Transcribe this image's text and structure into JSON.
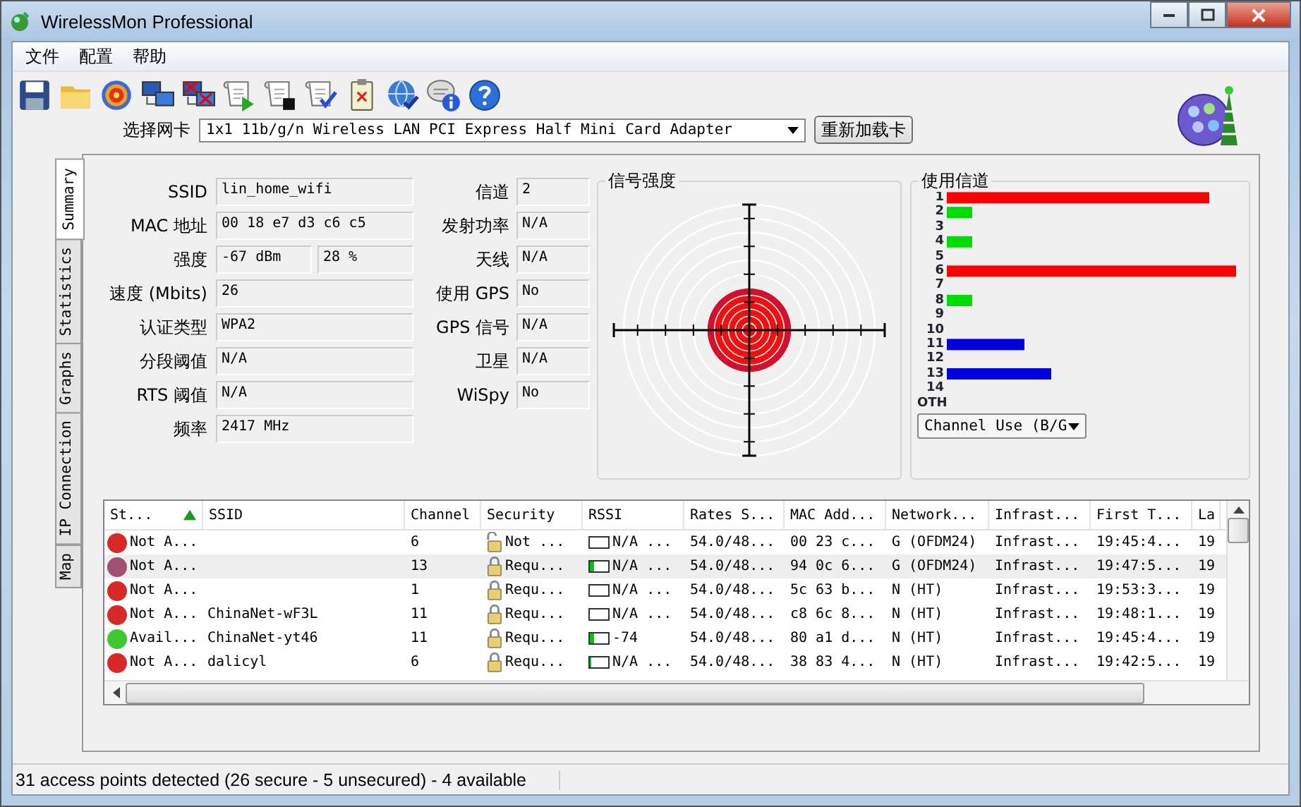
{
  "window": {
    "title": "WirelessMon Professional"
  },
  "menu": [
    "文件",
    "配置",
    "帮助"
  ],
  "adapter": {
    "label": "选择网卡",
    "value": "1x1 11b/g/n Wireless LAN PCI Express Half Mini Card Adapter",
    "reload": "重新加载卡"
  },
  "side_tabs": [
    {
      "label": "Summary",
      "selected": true
    },
    {
      "label": "Statistics",
      "selected": false
    },
    {
      "label": "Graphs",
      "selected": false
    },
    {
      "label": "IP Connection",
      "selected": false
    },
    {
      "label": "Map",
      "selected": false
    }
  ],
  "info_left": [
    {
      "label": "SSID",
      "values": [
        "lin_home_wifi"
      ]
    },
    {
      "label": "MAC 地址",
      "values": [
        "00 18 e7 d3 c6 c5"
      ]
    },
    {
      "label": "强度",
      "values": [
        "-67 dBm",
        "28 %"
      ]
    },
    {
      "label": "速度 (Mbits)",
      "values": [
        "26"
      ]
    },
    {
      "label": "认证类型",
      "values": [
        "WPA2"
      ]
    },
    {
      "label": "分段阈值",
      "values": [
        "N/A"
      ]
    },
    {
      "label": "RTS 阈值",
      "values": [
        "N/A"
      ]
    },
    {
      "label": "频率",
      "values": [
        "2417 MHz"
      ]
    }
  ],
  "info_right": [
    {
      "label": "信道",
      "value": "2"
    },
    {
      "label": "发射功率",
      "value": "N/A"
    },
    {
      "label": "天线",
      "value": "N/A"
    },
    {
      "label": "使用 GPS",
      "value": "No"
    },
    {
      "label": "GPS 信号",
      "value": "N/A"
    },
    {
      "label": "卫星",
      "value": "N/A"
    },
    {
      "label": "WiSpy",
      "value": "No"
    }
  ],
  "signal": {
    "title": "信号强度"
  },
  "channel_use": {
    "title": "使用信道",
    "mode": "Channel Use (B/G",
    "channels": [
      "1",
      "2",
      "3",
      "4",
      "5",
      "6",
      "7",
      "8",
      "9",
      "10",
      "11",
      "12",
      "13",
      "14",
      "OTH"
    ]
  },
  "table": {
    "columns": [
      {
        "label": "St...",
        "sorted": true
      },
      {
        "label": "SSID",
        "sorted": false
      },
      {
        "label": "Channel",
        "sorted": false
      },
      {
        "label": "Security",
        "sorted": false
      },
      {
        "label": "RSSI",
        "sorted": false
      },
      {
        "label": "Rates S...",
        "sorted": false
      },
      {
        "label": "MAC Add...",
        "sorted": false
      },
      {
        "label": "Network...",
        "sorted": false
      },
      {
        "label": "Infrast...",
        "sorted": false
      },
      {
        "label": "First T...",
        "sorted": false
      },
      {
        "label": "La",
        "sorted": false
      }
    ],
    "rows": [
      {
        "selected": false,
        "color": "#d82828",
        "secured": false,
        "level": 0,
        "cells": [
          "Not A...",
          "",
          "6",
          "Not ...",
          "N/A ...",
          "54.0/48...",
          "00 23 c...",
          "G (OFDM24)",
          "Infrast...",
          "19:45:4...",
          "19"
        ]
      },
      {
        "selected": true,
        "color": "#a05070",
        "secured": true,
        "level": 0.2,
        "cells": [
          "Not A...",
          "",
          "13",
          "Requ...",
          "N/A ...",
          "54.0/48...",
          "94 0c 6...",
          "G (OFDM24)",
          "Infrast...",
          "19:47:5...",
          "19"
        ]
      },
      {
        "selected": false,
        "color": "#d82828",
        "secured": true,
        "level": 0,
        "cells": [
          "Not A...",
          "",
          "1",
          "Requ...",
          "N/A ...",
          "54.0/48...",
          "5c 63 b...",
          "N (HT)",
          "Infrast...",
          "19:53:3...",
          "19"
        ]
      },
      {
        "selected": false,
        "color": "#d82828",
        "secured": true,
        "level": 0,
        "cells": [
          "Not A...",
          "ChinaNet-wF3L",
          "11",
          "Requ...",
          "N/A ...",
          "54.0/48...",
          "c8 6c 8...",
          "N (HT)",
          "Infrast...",
          "19:48:1...",
          "19"
        ]
      },
      {
        "selected": false,
        "color": "#40c830",
        "secured": true,
        "level": 0.25,
        "cells": [
          "Avail...",
          "ChinaNet-yt46",
          "11",
          "Requ...",
          "-74",
          "54.0/48...",
          "80 a1 d...",
          "N (HT)",
          "Infrast...",
          "19:45:4...",
          "19"
        ]
      },
      {
        "selected": false,
        "color": "#d82828",
        "secured": true,
        "level": 0.1,
        "cells": [
          "Not A...",
          "dalicyl",
          "6",
          "Requ...",
          "N/A ...",
          "54.0/48...",
          "38 83 4...",
          "N (HT)",
          "Infrast...",
          "19:42:5...",
          "19"
        ]
      }
    ]
  },
  "status_bar": "31 access points detected (26 secure - 5 unsecured) - 4 available"
}
